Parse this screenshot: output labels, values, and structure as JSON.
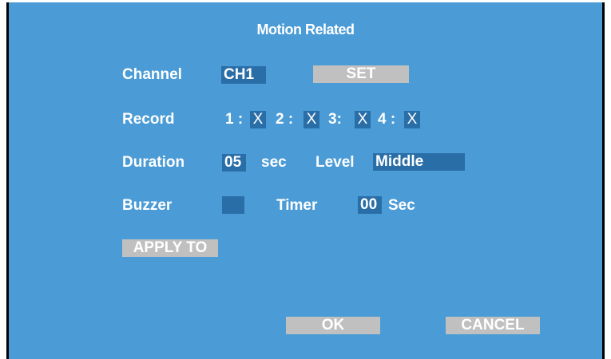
{
  "dialog": {
    "title": "Motion Related"
  },
  "channel": {
    "label": "Channel",
    "value": "CH1",
    "set_button": "SET"
  },
  "record": {
    "label": "Record",
    "slots": [
      {
        "label": "1 :",
        "value": "X"
      },
      {
        "label": "2 :",
        "value": "X"
      },
      {
        "label": "3:",
        "value": "X"
      },
      {
        "label": "4 :",
        "value": "X"
      }
    ]
  },
  "duration": {
    "label": "Duration",
    "value": "05",
    "unit": "sec"
  },
  "level": {
    "label": "Level",
    "value": "Middle"
  },
  "buzzer": {
    "label": "Buzzer",
    "value": ""
  },
  "timer": {
    "label": "Timer",
    "value": "00",
    "unit": "Sec"
  },
  "buttons": {
    "apply_to": "APPLY TO",
    "ok": "OK",
    "cancel": "CANCEL"
  },
  "colors": {
    "background": "#4a9bd6",
    "field": "#2a6ea8",
    "button": "#c0c0c0",
    "text": "#ffffff"
  }
}
